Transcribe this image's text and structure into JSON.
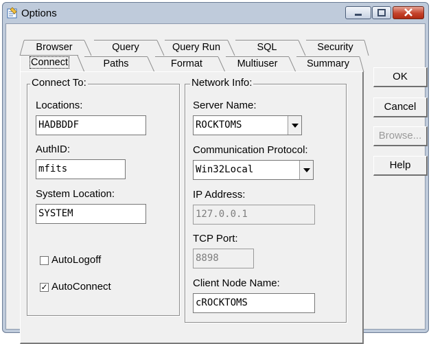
{
  "window": {
    "title": "Options",
    "icon": "options-app-icon"
  },
  "caption_buttons": {
    "minimize": "minimize-icon",
    "maximize": "maximize-icon",
    "close": "close-icon"
  },
  "tabs_row1": [
    {
      "label": "Browser"
    },
    {
      "label": "Query"
    },
    {
      "label": "Query Run"
    },
    {
      "label": "SQL"
    },
    {
      "label": "Security"
    }
  ],
  "tabs_row2": [
    {
      "label": "Connect"
    },
    {
      "label": "Paths"
    },
    {
      "label": "Format"
    },
    {
      "label": "Multiuser"
    },
    {
      "label": "Summary"
    }
  ],
  "active_tab": "Connect",
  "connect_to": {
    "legend": "Connect To:",
    "locations_label": "Locations:",
    "locations_value": "HADBDDF",
    "authid_label": "AuthID:",
    "authid_value": "mfits",
    "system_location_label": "System Location:",
    "system_location_value": "SYSTEM",
    "autologoff_label": "AutoLogoff",
    "autologoff_checked": false,
    "autoconnect_label": "AutoConnect",
    "autoconnect_checked": true,
    "check_mark": "✓"
  },
  "network_info": {
    "legend": "Network Info:",
    "server_name_label": "Server Name:",
    "server_name_value": "ROCKTOMS",
    "protocol_label": "Communication Protocol:",
    "protocol_value": "Win32Local",
    "ip_label": "IP Address:",
    "ip_value": "127.0.0.1",
    "tcp_port_label": "TCP Port:",
    "tcp_port_value": "8898",
    "client_node_label": "Client Node Name:",
    "client_node_value": "cROCKTOMS"
  },
  "buttons": {
    "ok": "OK",
    "cancel": "Cancel",
    "browse": "Browse...",
    "help": "Help"
  }
}
